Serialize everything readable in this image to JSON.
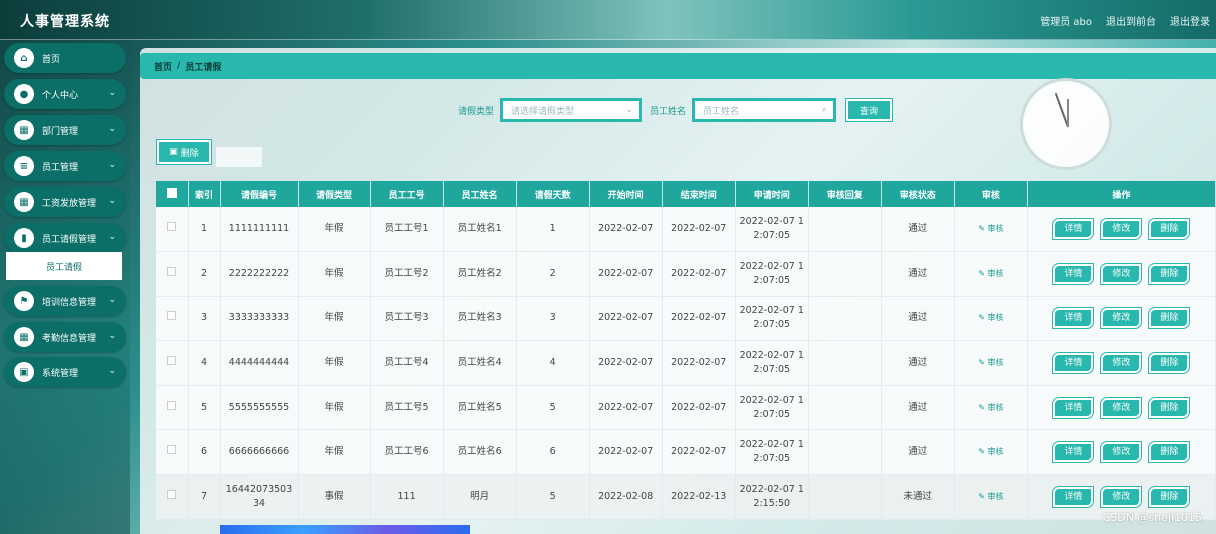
{
  "header": {
    "app_title": "人事管理系统",
    "admin_text": "管理员 abo",
    "back_to_front": "退出到前台",
    "logout": "退出登录"
  },
  "sidebar": {
    "items": [
      {
        "label": "首页",
        "icon": "home-icon",
        "has_chevron": false
      },
      {
        "label": "个人中心",
        "icon": "user-icon",
        "has_chevron": true
      },
      {
        "label": "部门管理",
        "icon": "grid-icon",
        "has_chevron": true
      },
      {
        "label": "员工管理",
        "icon": "sliders-icon",
        "has_chevron": true
      },
      {
        "label": "工资发放管理",
        "icon": "grid-icon",
        "has_chevron": true
      },
      {
        "label": "员工请假管理",
        "icon": "chart-icon",
        "has_chevron": true
      },
      {
        "label": "培训信息管理",
        "icon": "flag-icon",
        "has_chevron": true
      },
      {
        "label": "考勤信息管理",
        "icon": "grid-icon",
        "has_chevron": true
      },
      {
        "label": "系统管理",
        "icon": "trash-icon",
        "has_chevron": true
      }
    ],
    "submenu": {
      "label": "员工请假"
    }
  },
  "breadcrumb": {
    "home": "首页",
    "sep": "/",
    "current": "员工请假"
  },
  "search": {
    "leave_type_label": "请假类型",
    "leave_type_placeholder": "请选择请假类型",
    "employee_name_label": "员工姓名",
    "employee_name_placeholder": "员工姓名",
    "query_button": "查询"
  },
  "toolbar": {
    "delete_button": "删除",
    "delete_icon": "trash-icon"
  },
  "table": {
    "headers": [
      "",
      "索引",
      "请假编号",
      "请假类型",
      "员工工号",
      "员工姓名",
      "请假天数",
      "开始时间",
      "结束时间",
      "申请时间",
      "审核回复",
      "审核状态",
      "审核",
      "操作"
    ],
    "rows": [
      {
        "index": "1",
        "leave_no": "1111111111",
        "type": "年假",
        "emp_no": "员工工号1",
        "emp_name": "员工姓名1",
        "days": "1",
        "start": "2022-02-07",
        "end": "2022-02-07",
        "applied": "2022-02-07 1\n2:07:05",
        "reply": "",
        "status": "通过"
      },
      {
        "index": "2",
        "leave_no": "2222222222",
        "type": "年假",
        "emp_no": "员工工号2",
        "emp_name": "员工姓名2",
        "days": "2",
        "start": "2022-02-07",
        "end": "2022-02-07",
        "applied": "2022-02-07 1\n2:07:05",
        "reply": "",
        "status": "通过"
      },
      {
        "index": "3",
        "leave_no": "3333333333",
        "type": "年假",
        "emp_no": "员工工号3",
        "emp_name": "员工姓名3",
        "days": "3",
        "start": "2022-02-07",
        "end": "2022-02-07",
        "applied": "2022-02-07 1\n2:07:05",
        "reply": "",
        "status": "通过"
      },
      {
        "index": "4",
        "leave_no": "4444444444",
        "type": "年假",
        "emp_no": "员工工号4",
        "emp_name": "员工姓名4",
        "days": "4",
        "start": "2022-02-07",
        "end": "2022-02-07",
        "applied": "2022-02-07 1\n2:07:05",
        "reply": "",
        "status": "通过"
      },
      {
        "index": "5",
        "leave_no": "5555555555",
        "type": "年假",
        "emp_no": "员工工号5",
        "emp_name": "员工姓名5",
        "days": "5",
        "start": "2022-02-07",
        "end": "2022-02-07",
        "applied": "2022-02-07 1\n2:07:05",
        "reply": "",
        "status": "通过"
      },
      {
        "index": "6",
        "leave_no": "6666666666",
        "type": "年假",
        "emp_no": "员工工号6",
        "emp_name": "员工姓名6",
        "days": "6",
        "start": "2022-02-07",
        "end": "2022-02-07",
        "applied": "2022-02-07 1\n2:07:05",
        "reply": "",
        "status": "通过"
      },
      {
        "index": "7",
        "leave_no": "16442073503\n34",
        "type": "事假",
        "emp_no": "111",
        "emp_name": "明月",
        "days": "5",
        "start": "2022-02-08",
        "end": "2022-02-13",
        "applied": "2022-02-07 1\n2:15:50",
        "reply": "",
        "status": "未通过"
      }
    ],
    "audit_label": "审核",
    "audit_icon": "pencil-icon",
    "actions": {
      "detail": "详情",
      "edit": "修改",
      "delete": "删除"
    }
  },
  "watermark": "CSDN @sheji1015"
}
